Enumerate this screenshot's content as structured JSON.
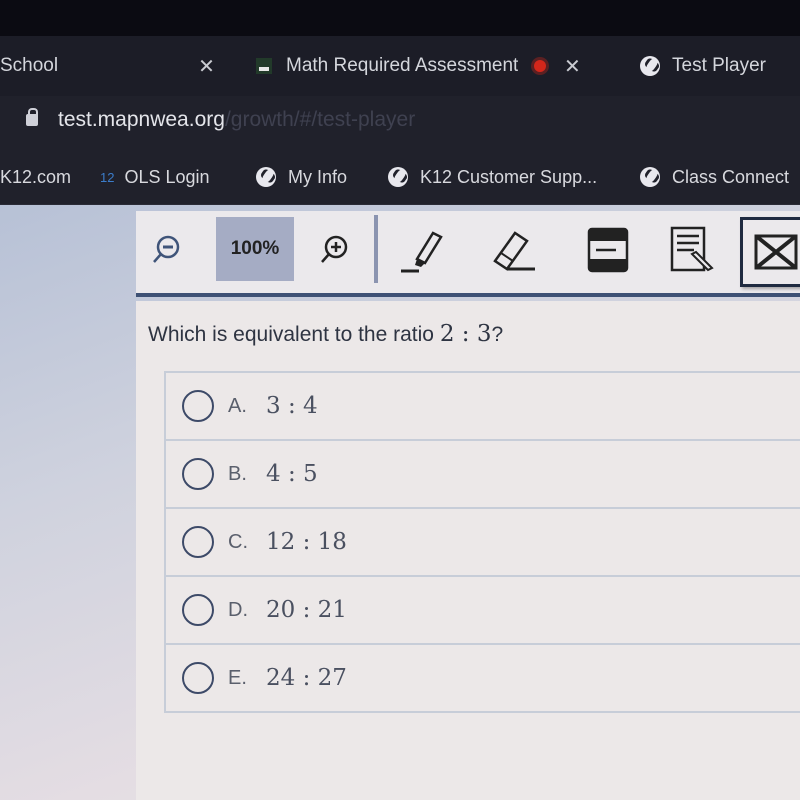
{
  "browser": {
    "tabs": [
      {
        "label": "School",
        "closable": true
      },
      {
        "label": "Math Required Assessment",
        "closable": true,
        "recording": true
      },
      {
        "label": "Test Player",
        "icon": "globe-icon"
      }
    ],
    "address": {
      "domain": "test.mapnwea.org",
      "path": "/growth/#/test-player"
    },
    "bookmarks": [
      {
        "label": "K12.com"
      },
      {
        "label": "OLS Login",
        "badge": "12"
      },
      {
        "label": "My Info",
        "icon": "globe-icon"
      },
      {
        "label": "K12 Customer Supp...",
        "icon": "globe-icon"
      },
      {
        "label": "Class Connect",
        "icon": "globe-icon"
      }
    ]
  },
  "toolbar": {
    "zoom_level": "100%",
    "tools": [
      "zoom-out",
      "zoom-in",
      "highlighter",
      "eraser",
      "line-reader",
      "notepad",
      "answer-eliminator"
    ]
  },
  "question": {
    "prompt": "Which is equivalent to the ratio ",
    "ratio": "2 : 3",
    "suffix": "?",
    "choices": [
      {
        "letter": "A.",
        "value": "3 : 4"
      },
      {
        "letter": "B.",
        "value": "4 : 5"
      },
      {
        "letter": "C.",
        "value": "12 : 18"
      },
      {
        "letter": "D.",
        "value": "20 : 21"
      },
      {
        "letter": "E.",
        "value": "24 : 27"
      }
    ]
  }
}
